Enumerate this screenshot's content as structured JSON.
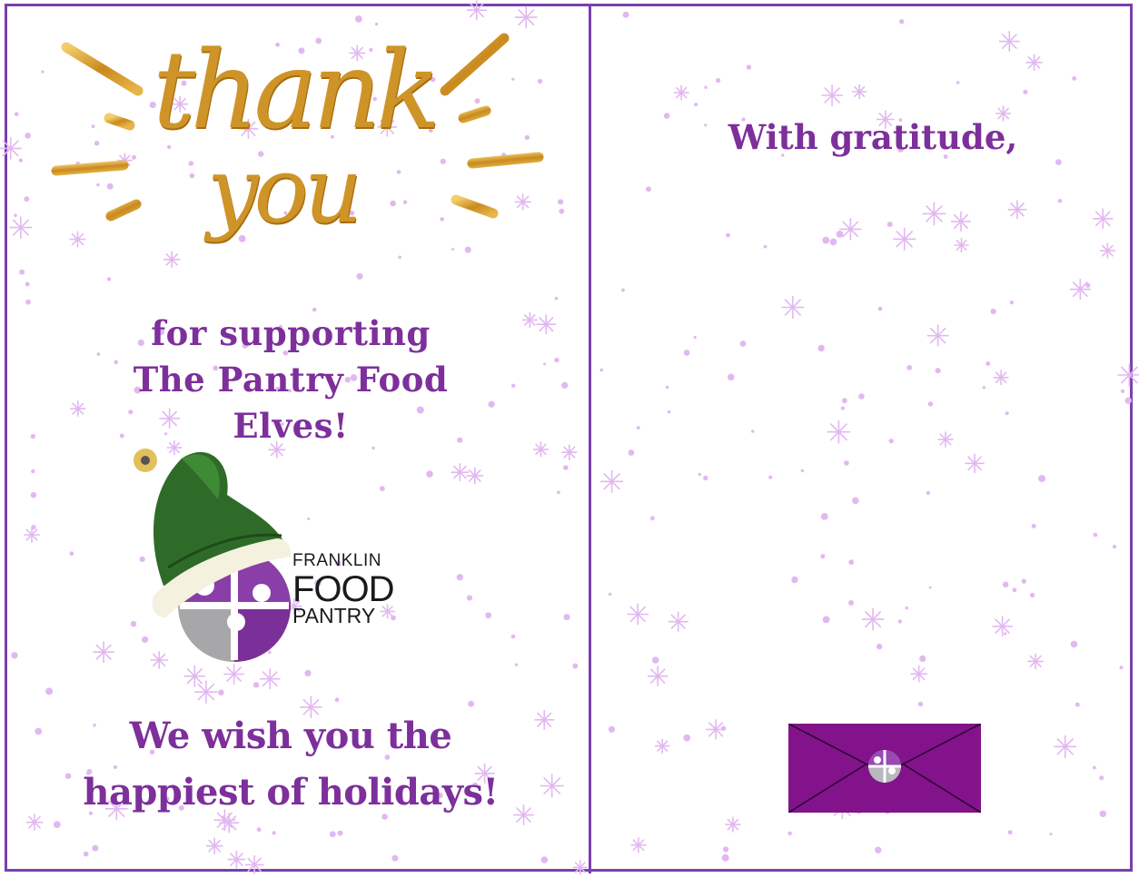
{
  "card": {
    "border_color": "#7a3fae",
    "accent_color": "#7d2f9b",
    "snow_color": "#e2b8f0"
  },
  "front": {
    "thank_you_line1": "thank",
    "thank_you_line2": "you",
    "support_line1": "for supporting",
    "support_line2": "The Pantry Food",
    "support_line3": "Elves!",
    "logo_line1": "FRANKLIN",
    "logo_line2": "FOOD",
    "logo_line3": "PANTRY",
    "wish_line1": "We wish you the",
    "wish_line2": "happiest of holidays!",
    "hat_color": "#2f6b28",
    "gold_color": "#d7a233"
  },
  "inside": {
    "greeting": "With gratitude,",
    "envelope_color": "#82138a",
    "icons": [
      "elf-hat-icon",
      "puzzle-logo-icon",
      "snowflake-icon",
      "envelope-icon"
    ]
  }
}
